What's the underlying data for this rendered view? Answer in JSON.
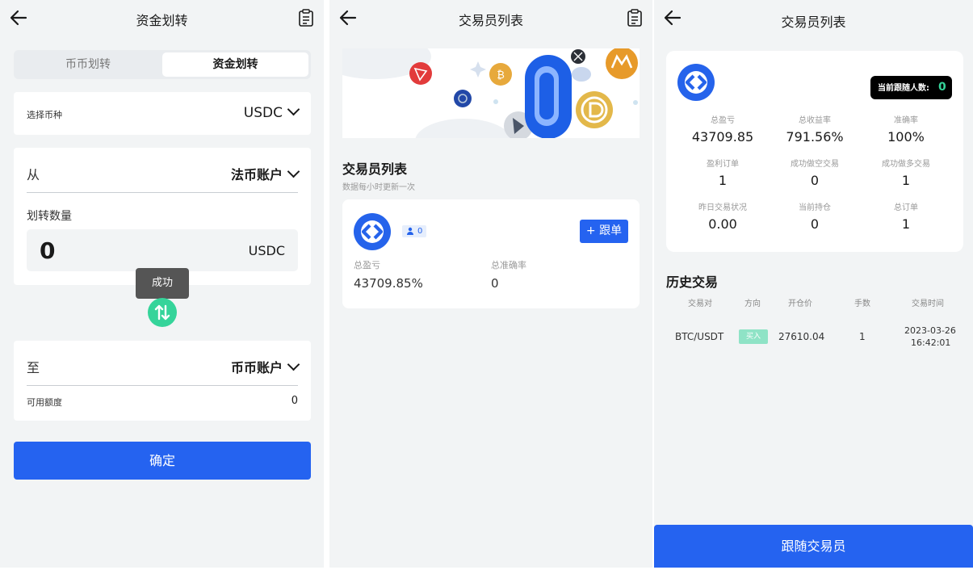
{
  "transfer": {
    "title": "资金划转",
    "tabs": [
      "币币划转",
      "资金划转"
    ],
    "select_coin_label": "选择币种",
    "coin": "USDC",
    "from_label": "从",
    "from_account": "法币账户",
    "amount_label": "划转数量",
    "amount_value": "0",
    "amount_unit": "USDC",
    "toast": "成功",
    "to_label": "至",
    "to_account": "币币账户",
    "available_label": "可用额度",
    "available_value": "0",
    "confirm": "确定"
  },
  "trader_list": {
    "title": "交易员列表",
    "section_title": "交易员列表",
    "section_subtitle": "数据每小时更新一次",
    "follower_count": "0",
    "follow_button": "+ 跟单",
    "stat1_label": "总盈亏",
    "stat1_value": "43709.85%",
    "stat2_label": "总准确率",
    "stat2_value": "0",
    "banner_big_digit": "0"
  },
  "trader_detail": {
    "title": "交易员列表",
    "followers_label": "当前跟随人数:",
    "followers_value": "0",
    "stats": [
      {
        "label": "总盈亏",
        "value": "43709.85"
      },
      {
        "label": "总收益率",
        "value": "791.56%"
      },
      {
        "label": "准确率",
        "value": "100%"
      },
      {
        "label": "盈利订单",
        "value": "1"
      },
      {
        "label": "成功做空交易",
        "value": "0"
      },
      {
        "label": "成功做多交易",
        "value": "1"
      },
      {
        "label": "昨日交易状况",
        "value": "0.00"
      },
      {
        "label": "当前持仓",
        "value": "0"
      },
      {
        "label": "总订单",
        "value": "1"
      }
    ],
    "history_title": "历史交易",
    "history_headers": [
      "交易对",
      "方向",
      "开仓价",
      "手数",
      "交易时间"
    ],
    "history_rows": [
      {
        "pair": "BTC/USDT",
        "direction": "买入",
        "price": "27610.04",
        "lots": "1",
        "date": "2023-03-26",
        "time": "16:42:01"
      }
    ],
    "follow_button": "跟随交易员"
  },
  "colors": {
    "primary": "#2563f0",
    "success": "#35d49a",
    "buy": "#8fe3c6",
    "bg": "#f2f4f5"
  }
}
